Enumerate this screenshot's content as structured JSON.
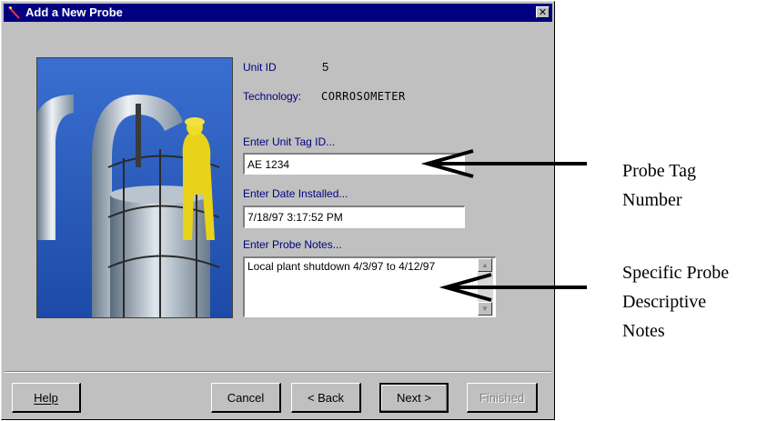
{
  "window": {
    "title": "Add a New Probe",
    "close_icon": "close-icon"
  },
  "info": {
    "unit_id_label": "Unit ID",
    "unit_id_value": "5",
    "technology_label": "Technology:",
    "technology_value": "CORROSOMETER"
  },
  "form": {
    "tag_label": "Enter Unit Tag ID...",
    "tag_value": "AE 1234",
    "date_label": "Enter Date Installed...",
    "date_value": "7/18/97 3:17:52 PM",
    "notes_label": "Enter Probe Notes...",
    "notes_value": "Local plant shutdown 4/3/97 to 4/12/97"
  },
  "buttons": {
    "help": "Help",
    "cancel": "Cancel",
    "back": "< Back",
    "next": "Next >",
    "finished": "Finished"
  },
  "annotations": {
    "tag_line1": "Probe Tag",
    "tag_line2": "Number",
    "notes_line1": "Specific Probe",
    "notes_line2": "Descriptive",
    "notes_line3": "Notes"
  },
  "colors": {
    "titlebar": "#000080",
    "dialog": "#c0c0c0",
    "label": "#000080"
  }
}
